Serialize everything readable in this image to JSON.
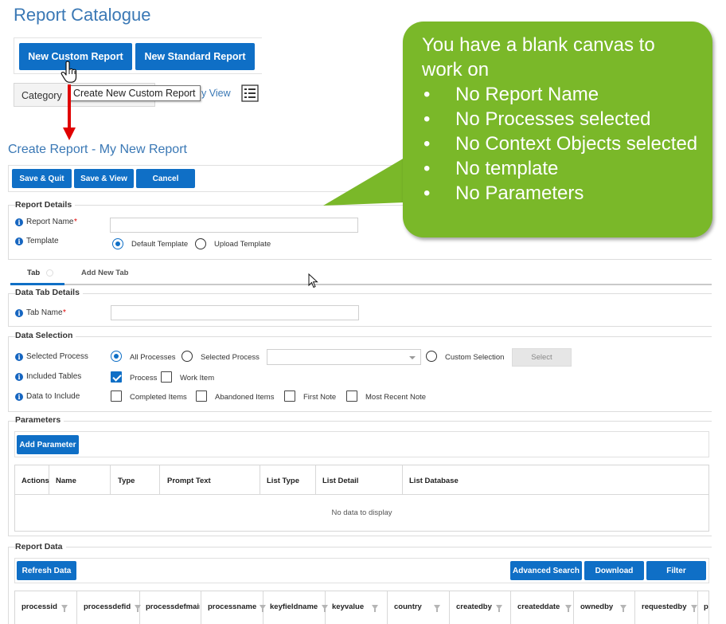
{
  "page": {
    "title": "Report Catalogue"
  },
  "catalogue": {
    "new_custom_report": "New Custom Report",
    "new_standard_report": "New Standard Report",
    "tooltip": "Create New Custom Report",
    "category_label": "Category",
    "view_fragment": "y View"
  },
  "create": {
    "title": "Create Report - My New Report",
    "save_quit": "Save & Quit",
    "save_view": "Save & View",
    "cancel": "Cancel"
  },
  "report_details": {
    "section": "Report Details",
    "report_name_label": "Report Name",
    "required_mark": "*",
    "template_label": "Template",
    "default_template": "Default Template",
    "upload_template": "Upload Template"
  },
  "tabs": {
    "tab": "Tab",
    "add_new_tab": "Add New Tab"
  },
  "data_tab": {
    "section": "Data Tab Details",
    "tab_name_label": "Tab Name",
    "required_mark": "*"
  },
  "data_selection": {
    "section": "Data Selection",
    "selected_process_label": "Selected Process",
    "all_processes": "All Processes",
    "selected_process_option": "Selected Process",
    "custom_selection": "Custom Selection",
    "select_button": "Select",
    "included_tables_label": "Included Tables",
    "process": "Process",
    "work_item": "Work Item",
    "data_to_include_label": "Data to Include",
    "completed_items": "Completed Items",
    "abandoned_items": "Abandoned Items",
    "first_note": "First Note",
    "most_recent_note": "Most Recent Note"
  },
  "parameters": {
    "section": "Parameters",
    "add_parameter": "Add Parameter",
    "columns": [
      "Actions",
      "Name",
      "Type",
      "Prompt Text",
      "List Type",
      "List Detail",
      "List Database"
    ],
    "empty": "No data to display"
  },
  "report_data": {
    "section": "Report Data",
    "refresh": "Refresh Data",
    "advanced_search": "Advanced Search",
    "download": "Download",
    "filter": "Filter",
    "columns": [
      "processid",
      "processdefid",
      "processdefmain",
      "processname",
      "keyfieldname",
      "keyvalue",
      "country",
      "createdby",
      "createddate",
      "ownedby",
      "requestedby",
      "p"
    ]
  },
  "callout": {
    "heading": "You have a blank canvas to work on",
    "bullet": "•",
    "items": [
      "No Report Name",
      "No Processes selected",
      "No Context Objects selected",
      "No template",
      "No Parameters"
    ],
    "color": "#7ab829"
  },
  "colors": {
    "accent": "#0f6fc6",
    "title": "#3a78b5",
    "arrow": "#e00000"
  }
}
